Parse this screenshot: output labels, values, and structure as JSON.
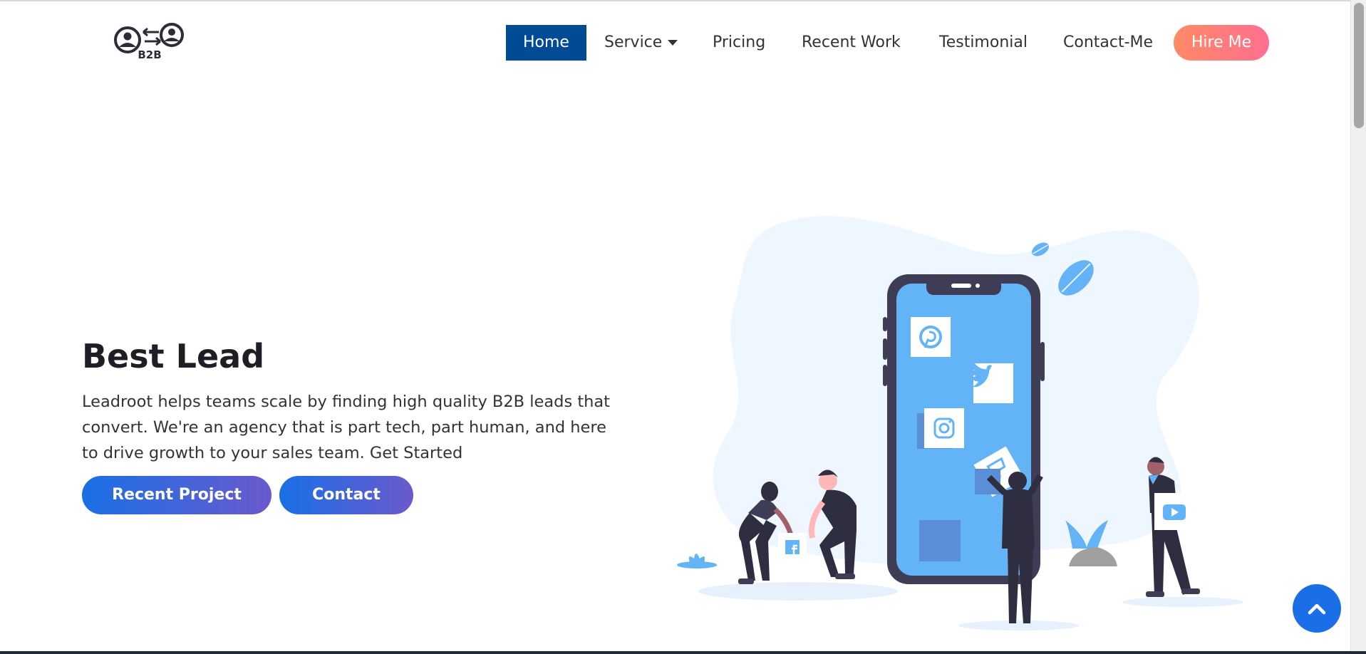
{
  "nav": {
    "logo_text": "B2B",
    "items": [
      {
        "label": "Home"
      },
      {
        "label": "Service"
      },
      {
        "label": "Pricing"
      },
      {
        "label": "Recent Work"
      },
      {
        "label": "Testimonial"
      },
      {
        "label": "Contact-Me"
      }
    ],
    "hire_label": "Hire Me"
  },
  "hero": {
    "title": "Best Lead",
    "description": "Leadroot helps teams scale by finding high quality B2B leads that convert. We're an agency that is part tech, part human, and here to drive growth to your sales team. Get Started",
    "buttons": {
      "recent_project": "Recent Project",
      "contact": "Contact"
    }
  },
  "illustration": {
    "icons": [
      "pinterest-icon",
      "twitter-icon",
      "instagram-icon",
      "foursquare-icon",
      "facebook-icon",
      "youtube-icon"
    ]
  },
  "colors": {
    "active_nav": "#004b93",
    "accent_blue": "#1a6fe6",
    "accent_purple": "#6a5acd",
    "hire_gradient_start": "#ff8a65",
    "hire_gradient_end": "#ff6f91",
    "illustration_bg": "#eef6ff",
    "phone_body": "#3f3d56",
    "phone_screen": "#63b3f7"
  }
}
